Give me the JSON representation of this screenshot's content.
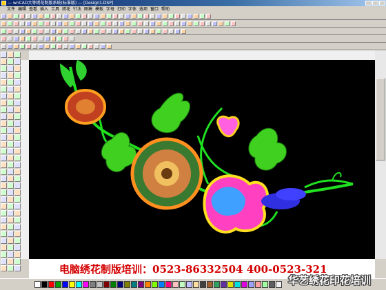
{
  "window": {
    "title": "— wnCAD大等绣花制版系统(标准版) — [Design1.DSP]"
  },
  "menu": {
    "items": [
      "文件",
      "编辑",
      "查看",
      "插入",
      "工具",
      "绣花",
      "针法",
      "图稿",
      "模板",
      "字母",
      "打印",
      "字体",
      "选项",
      "窗口",
      "帮助"
    ]
  },
  "colors": {
    "canvas_bg": "#000000",
    "banner_text": "#d40000",
    "palette": [
      "#ffffff",
      "#000000",
      "#ff0000",
      "#00a000",
      "#0000ff",
      "#ffff00",
      "#00ffff",
      "#ff00ff",
      "#808080",
      "#c0c0c0",
      "#800000",
      "#008000",
      "#000080",
      "#808000",
      "#008080",
      "#800080",
      "#ff8000",
      "#80ff00",
      "#0080ff",
      "#ff0080",
      "#ffc0c0",
      "#c0ffc0",
      "#c0c0ff",
      "#ffe0a0",
      "#404040",
      "#a06030",
      "#30a060",
      "#6030a0",
      "#e0e000",
      "#00e0e0",
      "#e000e0",
      "#a0a0ff",
      "#ffa0a0",
      "#a0ffa0",
      "#606060",
      "#f0f0f0"
    ]
  },
  "icons": {
    "window_controls": [
      "minimize-icon",
      "maximize-icon",
      "close-icon"
    ]
  },
  "banner": {
    "text": "电脑绣花制版培训：0523-86332504   400-0523-321"
  },
  "watermark": {
    "text": "华艺绣花印花培训"
  }
}
